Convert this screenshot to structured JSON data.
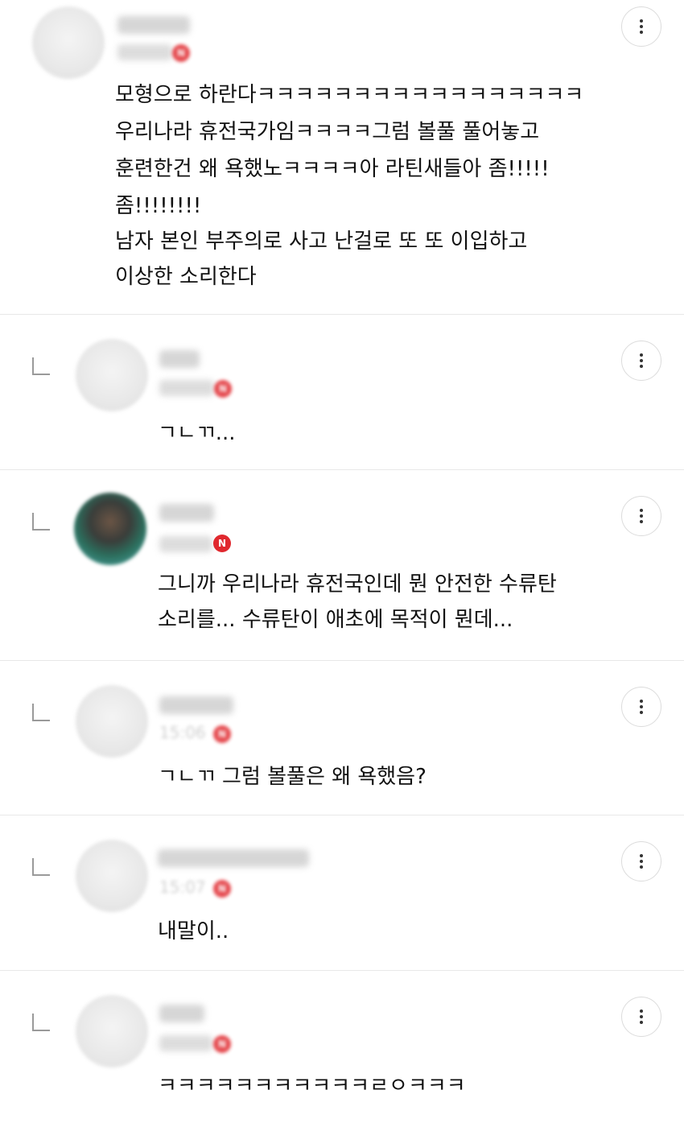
{
  "comments": [
    {
      "is_reply": false,
      "author": "",
      "time": "",
      "lines": [
        "모형으로 하란다ㅋㅋㅋㅋㅋㅋㅋㅋㅋㅋㅋㅋㅋㅋㅋㅋㅋ",
        "우리나라 휴전국가임ㅋㅋㅋㅋ그럼 볼풀 풀어놓고",
        "훈련한건 왜 욕했노ㅋㅋㅋㅋ아 라틴새들아 좀!!!!!",
        "좀!!!!!!!!",
        "남자 본인 부주의로 사고 난걸로 또 또 이입하고",
        "이상한 소리한다"
      ],
      "badge": "N"
    },
    {
      "is_reply": true,
      "author": "",
      "time": "",
      "lines": [
        "ㄱㄴㄲ..."
      ],
      "badge": "N"
    },
    {
      "is_reply": true,
      "author": "",
      "time": "",
      "lines": [
        "그니까 우리나라 휴전국인데 뭔 안전한 수류탄",
        "소리를... 수류탄이 애초에 목적이 뭔데..."
      ],
      "badge": "N"
    },
    {
      "is_reply": true,
      "author": "",
      "time": "15:06",
      "lines": [
        "ㄱㄴㄲ 그럼 볼풀은 왜 욕했음?"
      ],
      "badge": "N"
    },
    {
      "is_reply": true,
      "author": "",
      "time": "15:07",
      "lines": [
        "내말이.."
      ],
      "badge": "N"
    },
    {
      "is_reply": true,
      "author": "",
      "time": "",
      "lines": [
        "ㅋㅋㅋㅋㅋㅋㅋㅋㅋㅋㅋㄹㅇㅋㅋㅋ"
      ],
      "badge": "N"
    }
  ],
  "icons": {
    "more": "more-vertical-icon",
    "reply": "reply-corner-icon",
    "badge": "new-badge-icon"
  },
  "colors": {
    "badge_red": "#e0282e",
    "divider": "#e8e8e8",
    "text": "#111111"
  }
}
